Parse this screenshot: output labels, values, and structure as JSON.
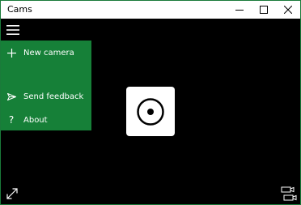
{
  "window": {
    "title": "Cams"
  },
  "titlebar_buttons": {
    "minimize": "minimize-icon",
    "maximize": "maximize-icon",
    "close": "close-icon"
  },
  "menu": {
    "icon": "hamburger-icon",
    "items": [
      {
        "label": "New camera",
        "icon": "plus-icon"
      },
      {
        "label": "Send feedback",
        "icon": "send-icon"
      },
      {
        "label": "About",
        "icon": "question-icon"
      }
    ]
  },
  "controls": {
    "capture_icon": "record-icon",
    "expand_icon": "expand-icon",
    "switch_camera_icon": "switch-camera-icon"
  },
  "colors": {
    "accent": "#168038",
    "background": "#000000",
    "window_border": "#1a7a3a"
  }
}
